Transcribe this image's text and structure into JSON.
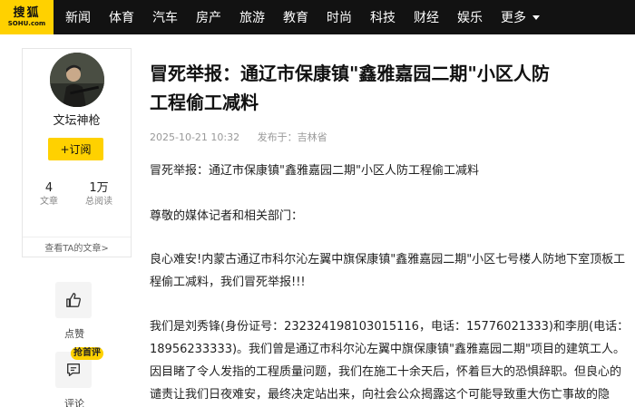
{
  "header": {
    "logo_cn": "搜狐",
    "logo_en": "SOHU.com",
    "nav": [
      "新闻",
      "体育",
      "汽车",
      "房产",
      "旅游",
      "教育",
      "时尚",
      "科技",
      "财经",
      "娱乐"
    ],
    "more_label": "更多"
  },
  "author": {
    "name": "文坛神枪",
    "follow_label": "+订阅",
    "articles_count": "4",
    "articles_label": "文章",
    "reads_count": "1万",
    "reads_label": "总阅读",
    "view_link": "查看TA的文章>"
  },
  "actions": {
    "like_label": "点赞",
    "comment_label": "评论",
    "comment_badge": "抢首评"
  },
  "article": {
    "title_line1": "冒死举报：通辽市保康镇\"鑫雅嘉园二期\"小区人防",
    "title_line2": "工程偷工减料",
    "date": "2025-10-21 10:32",
    "source": "发布于：吉林省",
    "p1": "冒死举报：通辽市保康镇\"鑫雅嘉园二期\"小区人防工程偷工减料",
    "p2": "尊敬的媒体记者和相关部门：",
    "p3_line1": "良心难安!内蒙古通辽市科尔沁左翼中旗保康镇\"鑫雅嘉园二期\"小区七号楼人防地下室顶板工",
    "p3_line2": "程偷工减料，我们冒死举报!!!",
    "p4_line1": "我们是刘秀锋(身份证号：232324198103015116，电话：15776021333)和李朋(电话：",
    "p4_line2": "18956233333)。我们曾是通辽市科尔沁左翼中旗保康镇\"鑫雅嘉园二期\"项目的建筑工人。",
    "p4_line3": "因目睹了令人发指的工程质量问题，我们在施工十余天后，怀着巨大的恐惧辞职。但良心的",
    "p4_line4": "谴责让我们日夜难安，最终决定站出来，向社会公众揭露这个可能导致重大伤亡事故的隐"
  }
}
